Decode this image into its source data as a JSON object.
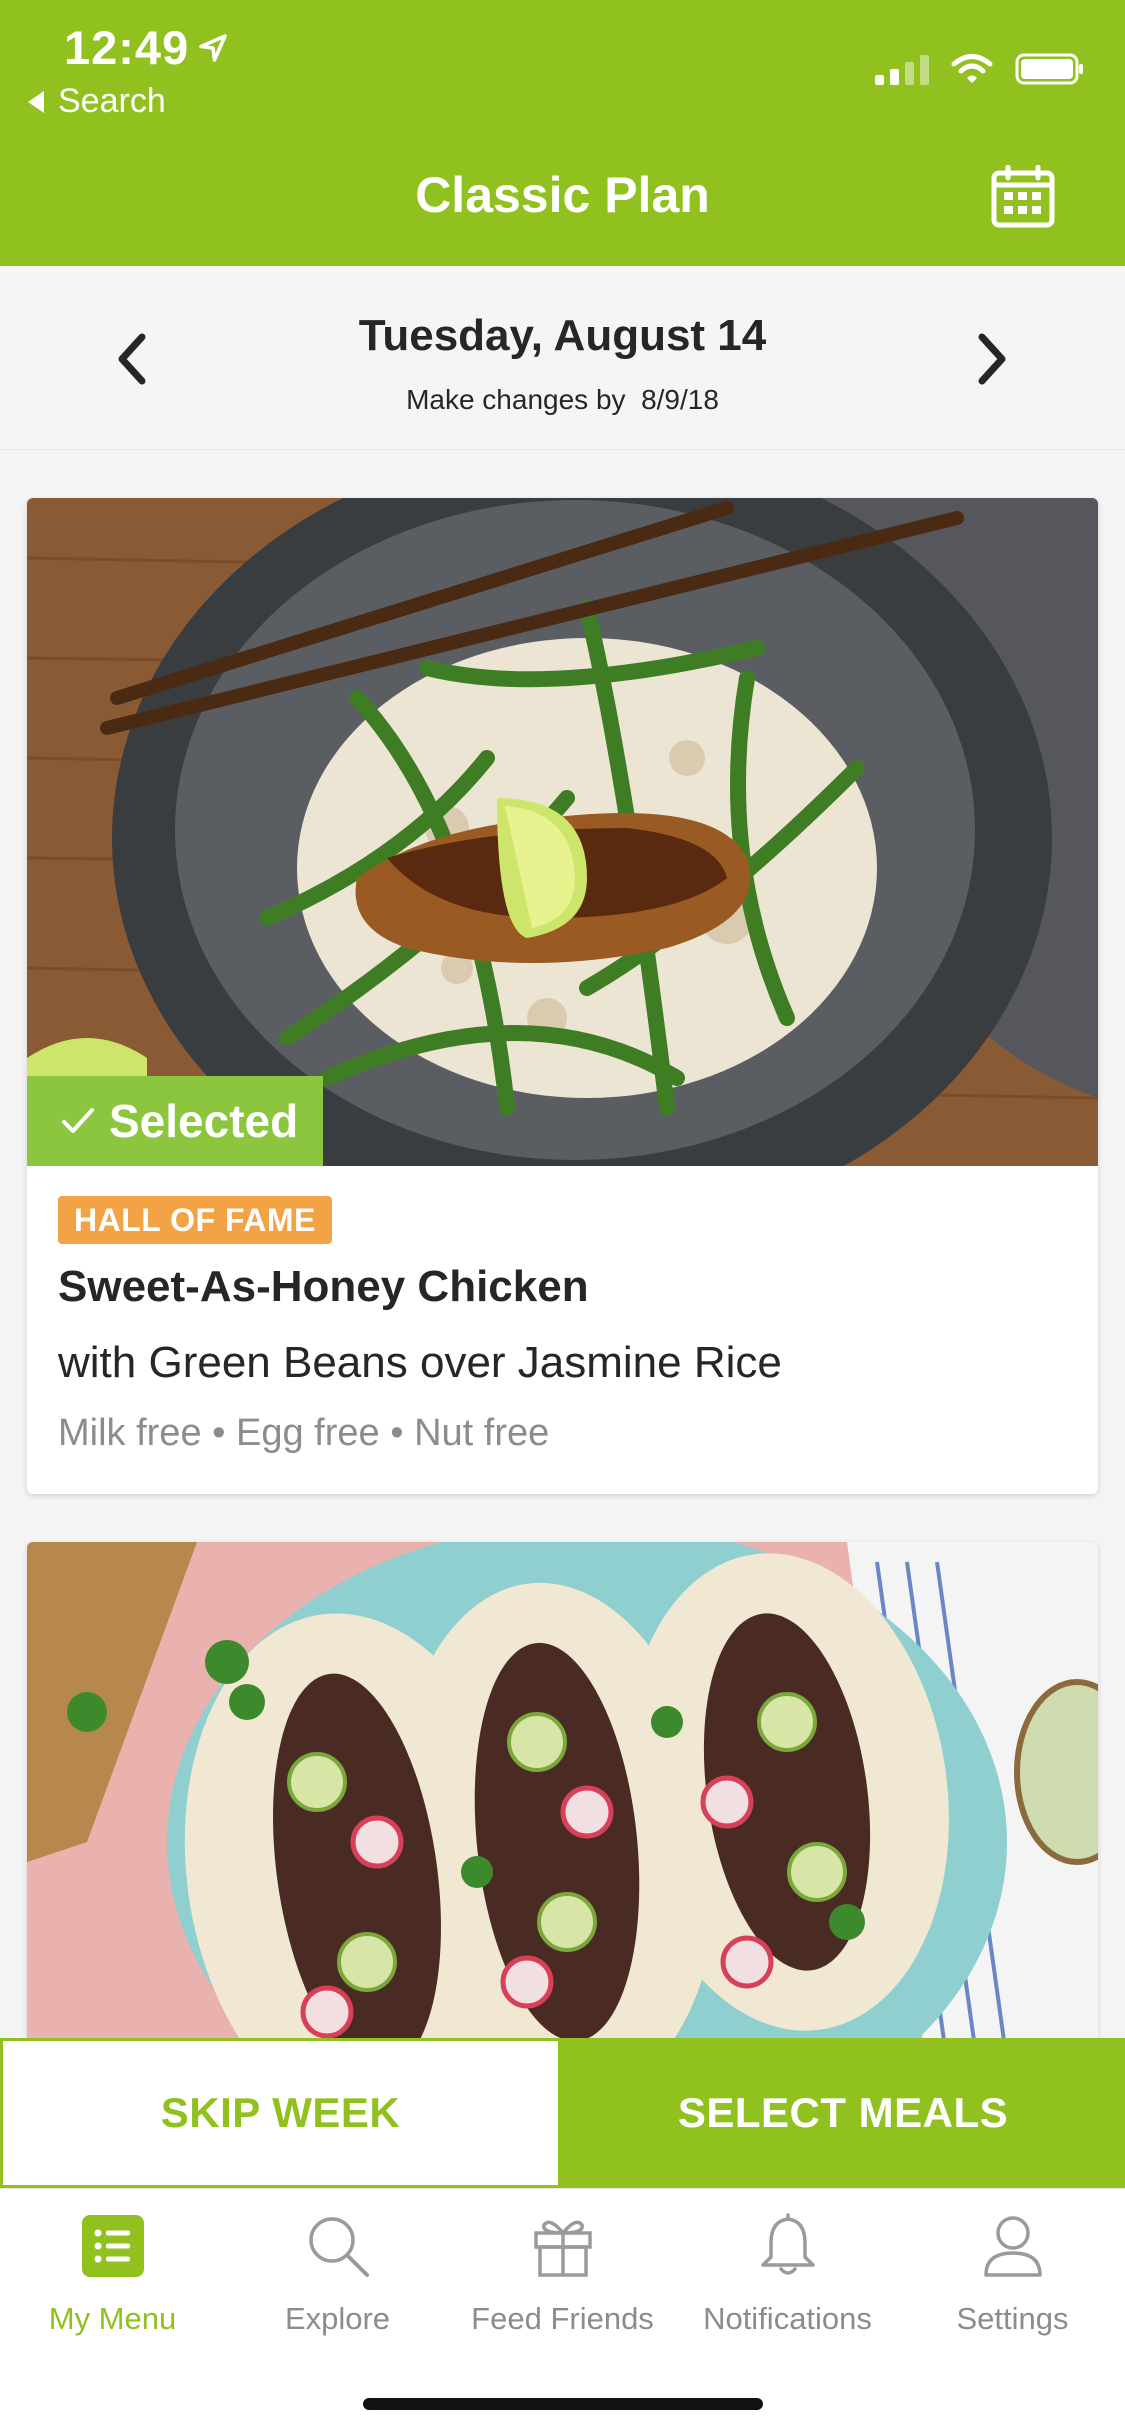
{
  "status_bar": {
    "time": "12:49",
    "back_label": "Search"
  },
  "header": {
    "title": "Classic Plan",
    "calendar_icon": "calendar-icon"
  },
  "date_bar": {
    "date": "Tuesday, August 14",
    "deadline": "Make changes by  8/9/18"
  },
  "recipes": [
    {
      "selected_label": "Selected",
      "tag": "HALL OF FAME",
      "name": "Sweet-As-Honey Chicken",
      "subtitle": "with Green Beans over Jasmine Rice",
      "dietary": "Milk free • Egg free • Nut free",
      "selected": true
    },
    {
      "selected": false
    }
  ],
  "actions": {
    "skip_label": "SKIP WEEK",
    "select_label": "SELECT MEALS"
  },
  "tabs": [
    {
      "label": "My Menu",
      "icon": "menu-list-icon",
      "active": true
    },
    {
      "label": "Explore",
      "icon": "search-icon",
      "active": false
    },
    {
      "label": "Feed Friends",
      "icon": "gift-icon",
      "active": false
    },
    {
      "label": "Notifications",
      "icon": "bell-icon",
      "active": false
    },
    {
      "label": "Settings",
      "icon": "person-icon",
      "active": false
    }
  ],
  "colors": {
    "brand_green": "#91c11e",
    "selected_green": "#8cc63e",
    "tag_orange": "#f2a346",
    "muted_text": "#8c8c8c"
  }
}
